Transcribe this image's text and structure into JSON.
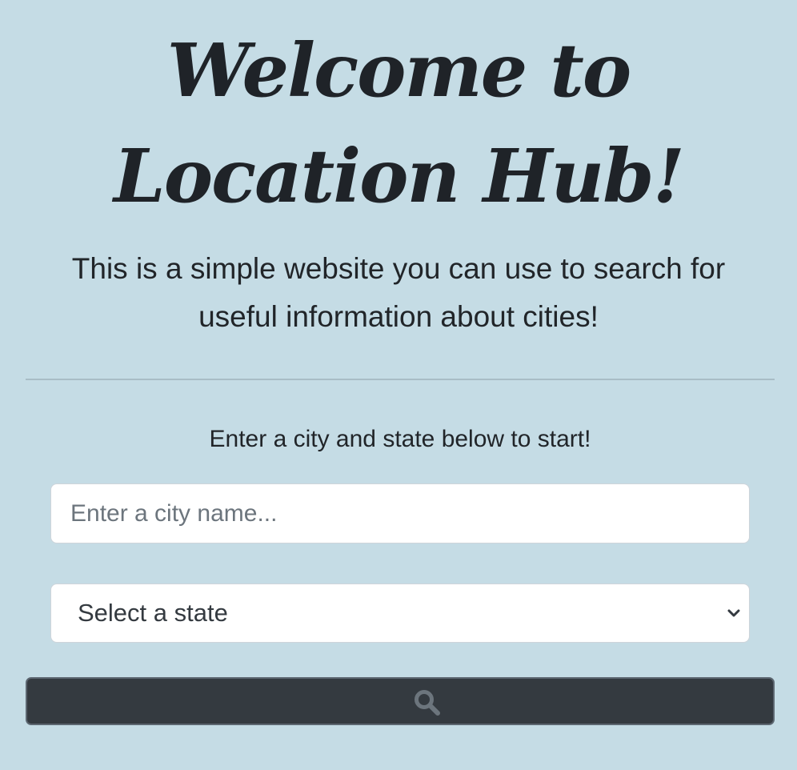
{
  "header": {
    "title": "Welcome to Location Hub!",
    "subtitle": "This is a simple website you can use to search for useful information about cities!"
  },
  "form": {
    "prompt": "Enter a city and state below to start!",
    "city_input": {
      "placeholder": "Enter a city name...",
      "value": ""
    },
    "state_select": {
      "selected": "Select a state",
      "icon": "chevron-down-icon"
    },
    "search_button": {
      "icon": "search-icon"
    }
  },
  "colors": {
    "background": "#c5dce5",
    "button": "#343a40",
    "text": "#212529"
  }
}
